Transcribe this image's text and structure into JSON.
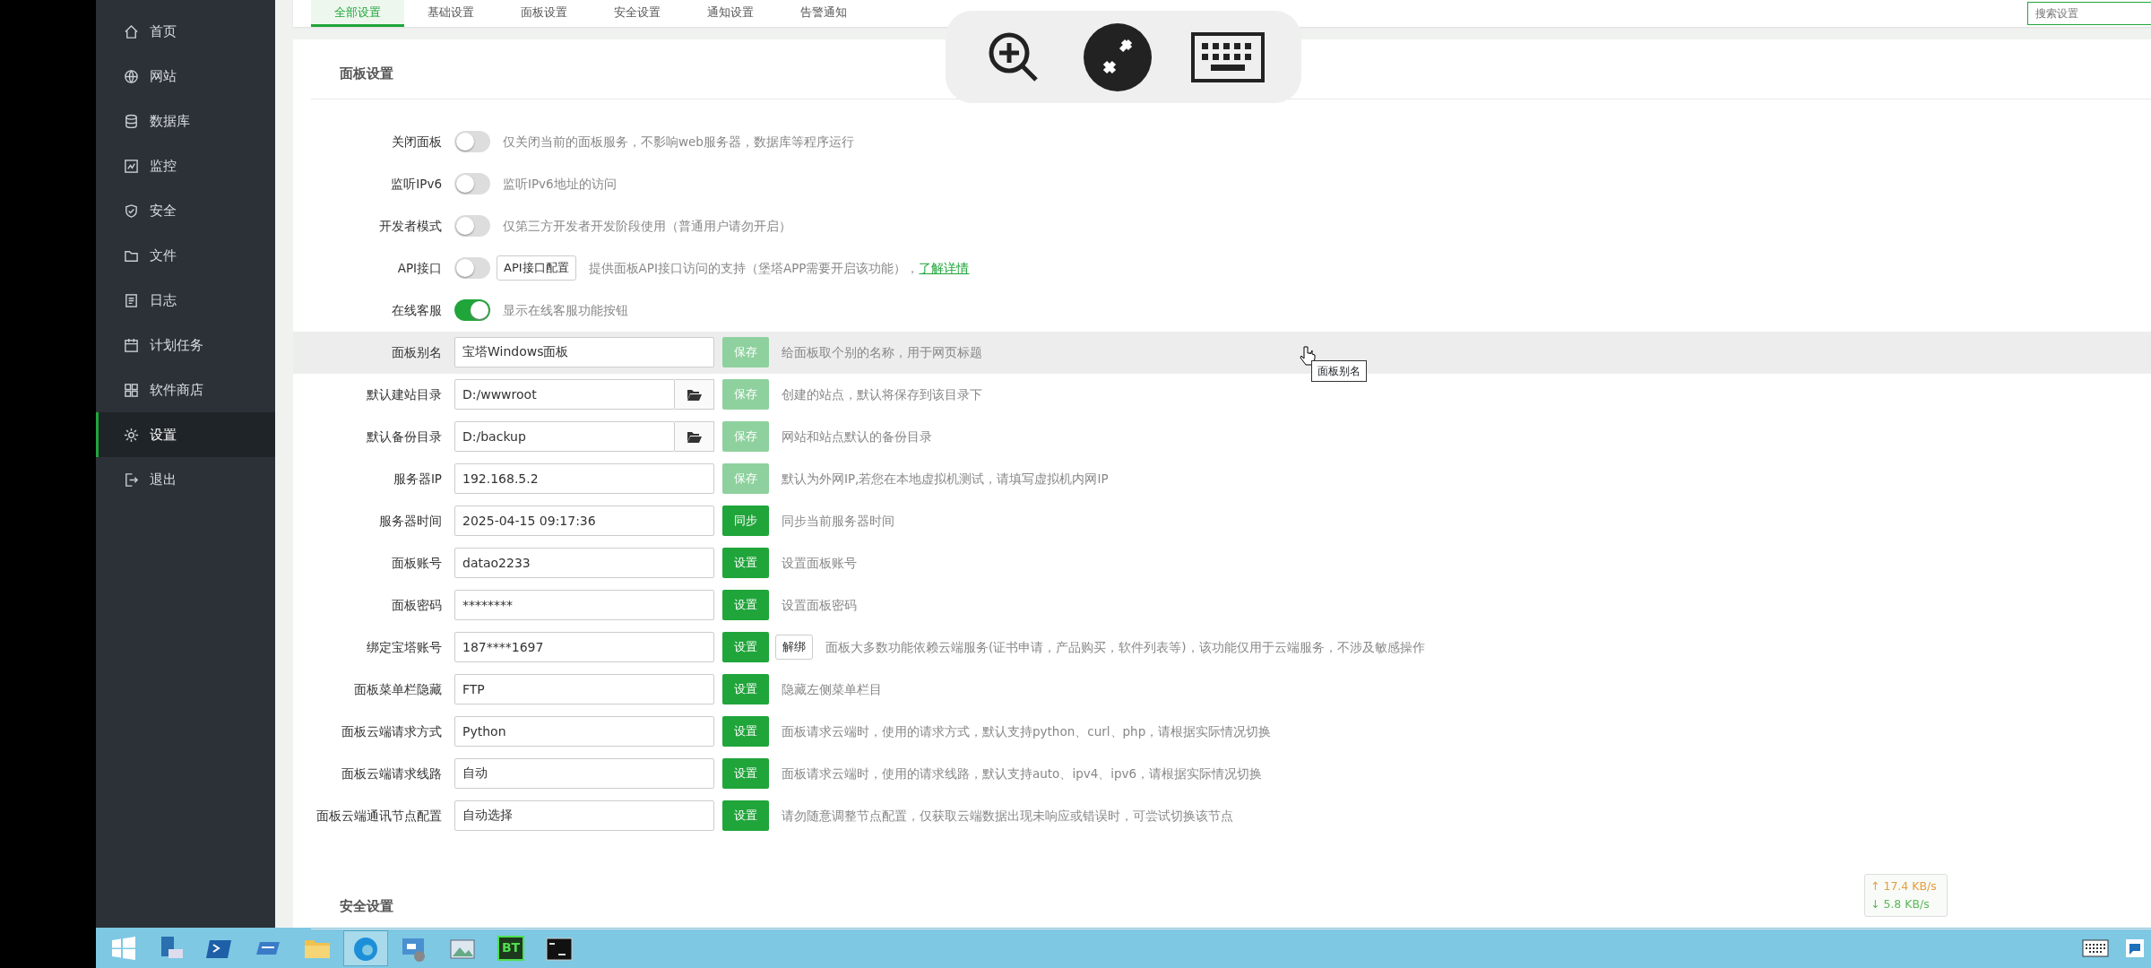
{
  "sidebar": {
    "items": [
      {
        "label": "首页",
        "selected": false
      },
      {
        "label": "网站",
        "selected": false
      },
      {
        "label": "数据库",
        "selected": false
      },
      {
        "label": "监控",
        "selected": false
      },
      {
        "label": "安全",
        "selected": false
      },
      {
        "label": "文件",
        "selected": false
      },
      {
        "label": "日志",
        "selected": false
      },
      {
        "label": "计划任务",
        "selected": false
      },
      {
        "label": "软件商店",
        "selected": false
      },
      {
        "label": "设置",
        "selected": true
      },
      {
        "label": "退出",
        "selected": false
      }
    ]
  },
  "tabs": [
    {
      "label": "全部设置",
      "selected": true
    },
    {
      "label": "基础设置",
      "selected": false
    },
    {
      "label": "面板设置",
      "selected": false
    },
    {
      "label": "安全设置",
      "selected": false
    },
    {
      "label": "通知设置",
      "selected": false
    },
    {
      "label": "告警通知",
      "selected": false
    }
  ],
  "search": {
    "placeholder": "搜索设置"
  },
  "panel": {
    "title": "面板设置",
    "rows": [
      {
        "kind": "toggle",
        "label": "关闭面板",
        "on": false,
        "desc": "仅关闭当前的面板服务，不影响web服务器，数据库等程序运行"
      },
      {
        "kind": "toggle",
        "label": "监听IPv6",
        "on": false,
        "desc": "监听IPv6地址的访问"
      },
      {
        "kind": "toggle",
        "label": "开发者模式",
        "on": false,
        "desc": "仅第三方开发者开发阶段使用（普通用户请勿开启）"
      },
      {
        "kind": "toggle",
        "label": "API接口",
        "on": false,
        "extra_button": "API接口配置",
        "desc": "提供面板API接口访问的支持（堡塔APP需要开启该功能），",
        "link": "了解详情"
      },
      {
        "kind": "toggle",
        "label": "在线客服",
        "on": true,
        "desc": "显示在线客服功能按钮"
      },
      {
        "kind": "input",
        "label": "面板别名",
        "value": "宝塔Windows面板",
        "button": "保存",
        "disabled": true,
        "hovered": true,
        "desc": "给面板取个别的名称，用于网页标题"
      },
      {
        "kind": "input",
        "label": "默认建站目录",
        "value": "D:/wwwroot",
        "browse": true,
        "button": "保存",
        "disabled": true,
        "desc": "创建的站点，默认将保存到该目录下"
      },
      {
        "kind": "input",
        "label": "默认备份目录",
        "value": "D:/backup",
        "browse": true,
        "button": "保存",
        "disabled": true,
        "desc": "网站和站点默认的备份目录"
      },
      {
        "kind": "input",
        "label": "服务器IP",
        "value": "192.168.5.2",
        "button": "保存",
        "disabled": true,
        "desc": "默认为外网IP,若您在本地虚拟机测试，请填写虚拟机内网IP"
      },
      {
        "kind": "input",
        "label": "服务器时间",
        "value": "2025-04-15 09:17:36",
        "button": "同步",
        "disabled": false,
        "desc": "同步当前服务器时间"
      },
      {
        "kind": "input",
        "label": "面板账号",
        "value": "datao2233",
        "button": "设置",
        "disabled": false,
        "desc": "设置面板账号"
      },
      {
        "kind": "input",
        "label": "面板密码",
        "value": "********",
        "button": "设置",
        "disabled": false,
        "desc": "设置面板密码"
      },
      {
        "kind": "input",
        "label": "绑定宝塔账号",
        "value": "187****1697",
        "button": "设置",
        "disabled": false,
        "extra_button": "解绑",
        "desc": "面板大多数功能依赖云端服务(证书申请，产品购买，软件列表等)，该功能仅用于云端服务，不涉及敏感操作"
      },
      {
        "kind": "input",
        "label": "面板菜单栏隐藏",
        "value": "FTP",
        "button": "设置",
        "disabled": false,
        "desc": "隐藏左侧菜单栏目"
      },
      {
        "kind": "input",
        "label": "面板云端请求方式",
        "value": "Python",
        "button": "设置",
        "disabled": false,
        "desc": "面板请求云端时，使用的请求方式，默认支持python、curl、php，请根据实际情况切换"
      },
      {
        "kind": "input",
        "label": "面板云端请求线路",
        "value": "自动",
        "button": "设置",
        "disabled": false,
        "desc": "面板请求云端时，使用的请求线路，默认支持auto、ipv4、ipv6，请根据实际情况切换"
      },
      {
        "kind": "input",
        "label": "面板云端通讯节点配置",
        "value": "自动选择",
        "button": "设置",
        "disabled": false,
        "desc": "请勿随意调整节点配置，仅获取云端数据出现未响应或错误时，可尝试切换该节点"
      }
    ]
  },
  "security": {
    "title": "安全设置"
  },
  "tooltip": "面板别名",
  "net_speed": {
    "up": "↑ 17.4 KB/s",
    "down": "↓ 5.8 KB/s"
  },
  "taskbar": {
    "apps": [
      {
        "active": false
      },
      {
        "active": false
      },
      {
        "active": false
      },
      {
        "active": false
      },
      {
        "active": true
      },
      {
        "active": false
      },
      {
        "active": false
      },
      {
        "label": "BT",
        "active": false
      },
      {
        "active": false
      }
    ]
  }
}
